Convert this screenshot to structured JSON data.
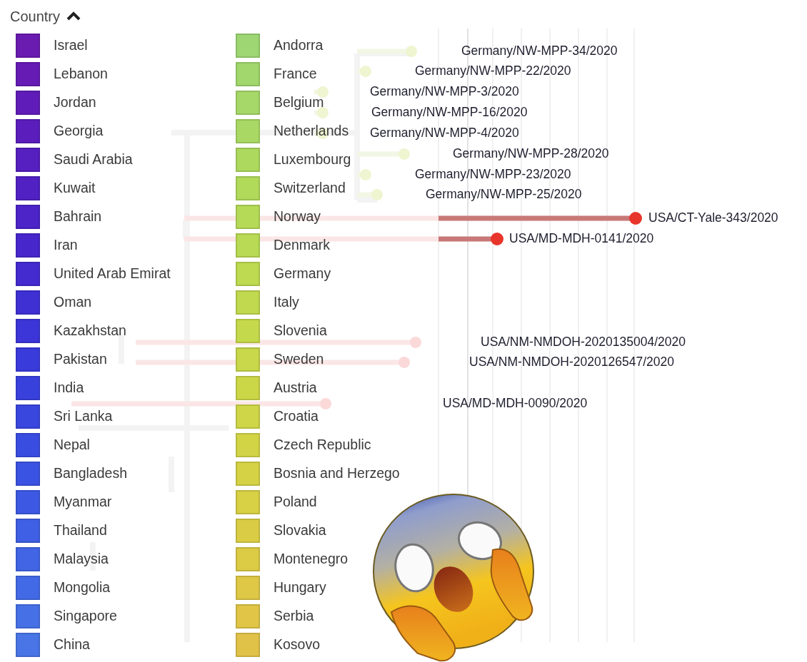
{
  "legend": {
    "title": "Country",
    "expanded": true,
    "items": [
      {
        "name": "Israel",
        "color": "#6a1bb0"
      },
      {
        "name": "Lebanon",
        "color": "#651bb4"
      },
      {
        "name": "Jordan",
        "color": "#601cb8"
      },
      {
        "name": "Georgia",
        "color": "#5b1dbc"
      },
      {
        "name": "Saudi Arabia",
        "color": "#561fc0"
      },
      {
        "name": "Kuwait",
        "color": "#5121c4"
      },
      {
        "name": "Bahrain",
        "color": "#4c24c8"
      },
      {
        "name": "Iran",
        "color": "#4727cc"
      },
      {
        "name": "United Arab Emirat",
        "color": "#432bd0"
      },
      {
        "name": "Oman",
        "color": "#3f30d4"
      },
      {
        "name": "Kazakhstan",
        "color": "#3c35d8"
      },
      {
        "name": "Pakistan",
        "color": "#3a3bdb"
      },
      {
        "name": "India",
        "color": "#3941dd"
      },
      {
        "name": "Sri Lanka",
        "color": "#3947df"
      },
      {
        "name": "Nepal",
        "color": "#3a4de1"
      },
      {
        "name": "Bangladesh",
        "color": "#3b53e2"
      },
      {
        "name": "Myanmar",
        "color": "#3d59e3"
      },
      {
        "name": "Thailand",
        "color": "#3f5fe4"
      },
      {
        "name": "Malaysia",
        "color": "#4165e5"
      },
      {
        "name": "Mongolia",
        "color": "#436ae6"
      },
      {
        "name": "Singapore",
        "color": "#4670e6"
      },
      {
        "name": "China",
        "color": "#4975e6"
      },
      {
        "name": "Andorra",
        "color": "#9dd672"
      },
      {
        "name": "France",
        "color": "#a1d76d"
      },
      {
        "name": "Belgium",
        "color": "#a5d868"
      },
      {
        "name": "Netherlands",
        "color": "#a9d964"
      },
      {
        "name": "Luxembourg",
        "color": "#add95f"
      },
      {
        "name": "Switzerland",
        "color": "#b1da5b"
      },
      {
        "name": "Norway",
        "color": "#b5da57"
      },
      {
        "name": "Denmark",
        "color": "#b9da54"
      },
      {
        "name": "Germany",
        "color": "#bdda51"
      },
      {
        "name": "Italy",
        "color": "#c1d94e"
      },
      {
        "name": "Slovenia",
        "color": "#c5d94c"
      },
      {
        "name": "Sweden",
        "color": "#c8d84a"
      },
      {
        "name": "Austria",
        "color": "#ccd748"
      },
      {
        "name": "Croatia",
        "color": "#cfd647"
      },
      {
        "name": "Czech Republic",
        "color": "#d2d446"
      },
      {
        "name": "Bosnia and Herzego",
        "color": "#d5d245"
      },
      {
        "name": "Poland",
        "color": "#d8d045"
      },
      {
        "name": "Slovakia",
        "color": "#dacd45"
      },
      {
        "name": "Montenegro",
        "color": "#dccb45"
      },
      {
        "name": "Hungary",
        "color": "#dec846"
      },
      {
        "name": "Serbia",
        "color": "#e0c547"
      },
      {
        "name": "Kosovo",
        "color": "#e1c248"
      }
    ]
  },
  "tree": {
    "tips": [
      {
        "label": "Germany/NW-MPP-34/2020",
        "color": "#eef5d0"
      },
      {
        "label": "Germany/NW-MPP-22/2020",
        "color": "#eef5d0"
      },
      {
        "label": "Germany/NW-MPP-3/2020",
        "color": "#eef5d0"
      },
      {
        "label": "Germany/NW-MPP-16/2020",
        "color": "#eef5d0"
      },
      {
        "label": "Germany/NW-MPP-4/2020",
        "color": "#eef5d0"
      },
      {
        "label": "Germany/NW-MPP-28/2020",
        "color": "#eef5d0"
      },
      {
        "label": "Germany/NW-MPP-23/2020",
        "color": "#eef5d0"
      },
      {
        "label": "Germany/NW-MPP-25/2020",
        "color": "#eef5d0"
      },
      {
        "label": "USA/CT-Yale-343/2020",
        "color": "#e8352b"
      },
      {
        "label": "USA/MD-MDH-0141/2020",
        "color": "#e8352b"
      },
      {
        "label": "USA/NM-NMDOH-2020135004/2020",
        "color": "#fbd9d9"
      },
      {
        "label": "USA/NM-NMDOH-2020126547/2020",
        "color": "#fbd9d9"
      },
      {
        "label": "USA/MD-MDH-0090/2020",
        "color": "#fbd9d9"
      }
    ]
  }
}
